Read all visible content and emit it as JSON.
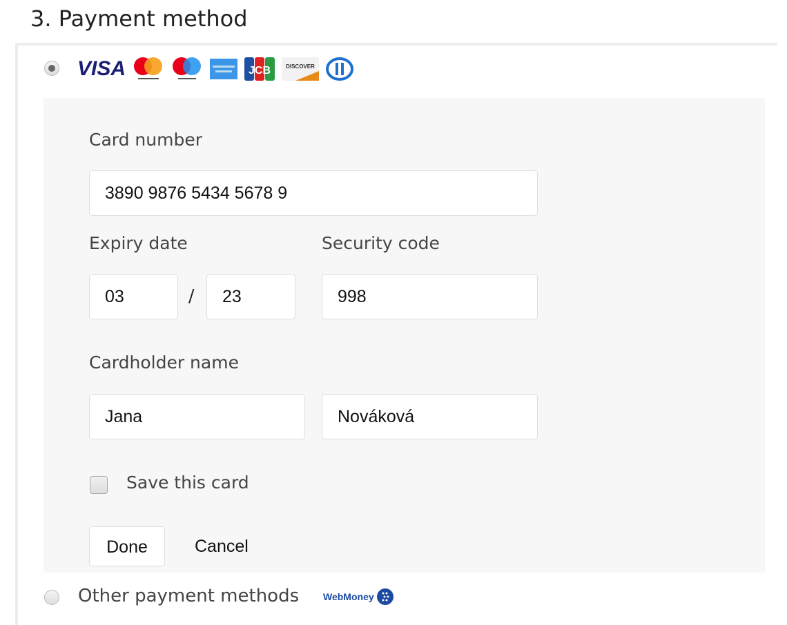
{
  "section_title": "3. Payment method",
  "card_option": {
    "selected": true,
    "logos": [
      "visa",
      "mastercard",
      "maestro",
      "american-express",
      "jcb",
      "discover",
      "diners-club"
    ]
  },
  "form": {
    "card_number_label": "Card number",
    "card_number": "3890 9876 5434 5678 9",
    "expiry_label": "Expiry date",
    "expiry_month": "03",
    "expiry_separator": "/",
    "expiry_year": "23",
    "security_label": "Security code",
    "security_code": "998",
    "cardholder_label": "Cardholder name",
    "first_name": "Jana",
    "last_name": "Nováková",
    "save_card_label": "Save this card",
    "save_card_checked": false,
    "done_label": "Done",
    "cancel_label": "Cancel"
  },
  "other_option": {
    "label": "Other payment methods",
    "selected": false,
    "logo": "WebMoney"
  }
}
